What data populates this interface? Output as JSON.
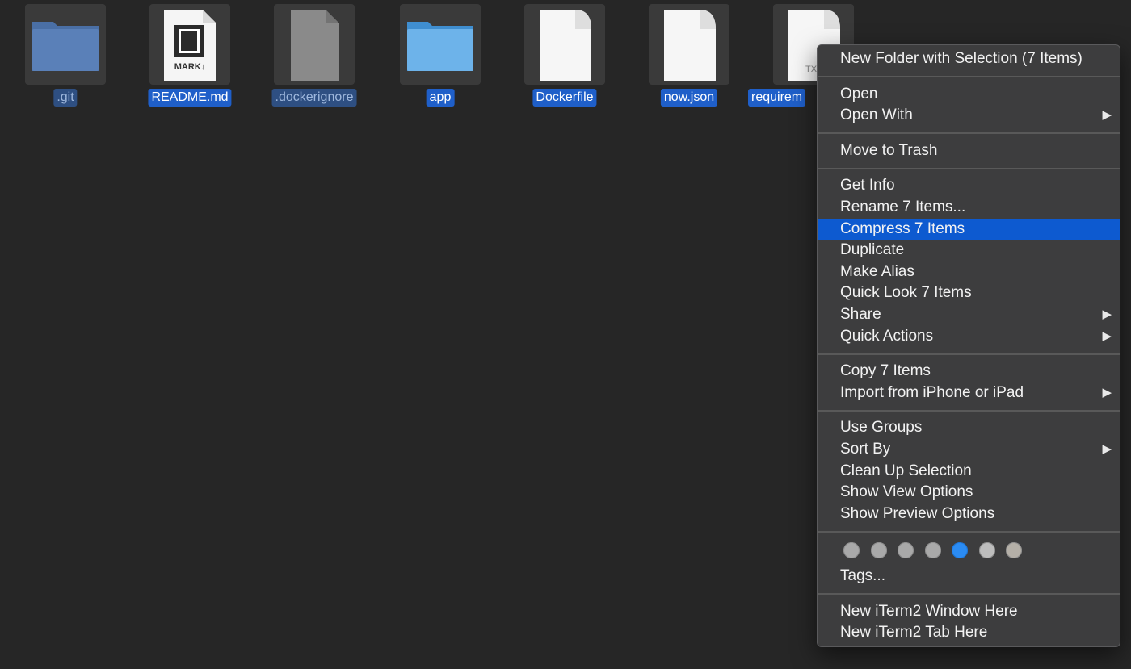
{
  "desktop": {
    "files": [
      {
        "name": ".git",
        "icon": "folder-icon",
        "selected": true,
        "dimmed": true
      },
      {
        "name": "README.md",
        "icon": "markdown-file-icon",
        "selected": true,
        "badge": "MARK↓"
      },
      {
        "name": ".dockerignore",
        "icon": "generic-file-icon",
        "selected": true,
        "dimmed": true
      },
      {
        "name": "app",
        "icon": "folder-icon",
        "selected": true
      },
      {
        "name": "Dockerfile",
        "icon": "blank-document-icon",
        "selected": true
      },
      {
        "name": "now.json",
        "icon": "blank-document-icon",
        "selected": true
      },
      {
        "name": "requirem",
        "icon": "text-document-icon",
        "selected": true,
        "badge": "TX"
      }
    ]
  },
  "context_menu": {
    "groups": [
      [
        {
          "label": "New Folder with Selection (7 Items)"
        }
      ],
      [
        {
          "label": "Open"
        },
        {
          "label": "Open With",
          "submenu": true
        }
      ],
      [
        {
          "label": "Move to Trash"
        }
      ],
      [
        {
          "label": "Get Info"
        },
        {
          "label": "Rename 7 Items..."
        },
        {
          "label": "Compress 7 Items",
          "highlighted": true
        },
        {
          "label": "Duplicate"
        },
        {
          "label": "Make Alias"
        },
        {
          "label": "Quick Look 7 Items"
        },
        {
          "label": "Share",
          "submenu": true
        },
        {
          "label": "Quick Actions",
          "submenu": true
        }
      ],
      [
        {
          "label": "Copy 7 Items"
        },
        {
          "label": "Import from iPhone or iPad",
          "submenu": true
        }
      ],
      [
        {
          "label": "Use Groups"
        },
        {
          "label": "Sort By",
          "submenu": true
        },
        {
          "label": "Clean Up Selection"
        },
        {
          "label": "Show View Options"
        },
        {
          "label": "Show Preview Options"
        }
      ]
    ],
    "tag_colors": [
      "#a9a9a9",
      "#a9a9a9",
      "#a9a9a9",
      "#a9a9a9",
      "#2b8bf2",
      "#bdbdbd",
      "#b5b0a8"
    ],
    "tags_label": "Tags...",
    "bottom_group": [
      {
        "label": "New iTerm2 Window Here"
      },
      {
        "label": "New iTerm2 Tab Here"
      }
    ],
    "submenu_arrow": "▶",
    "highlight_color": "#0d5ad0"
  }
}
